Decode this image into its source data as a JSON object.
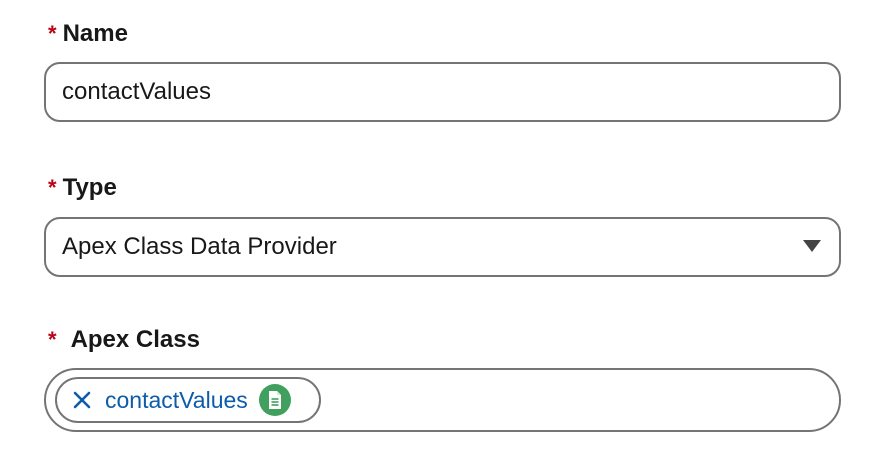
{
  "name_field": {
    "required_marker": "*",
    "label": "Name",
    "value": "contactValues"
  },
  "type_field": {
    "required_marker": "*",
    "label": "Type",
    "selected_value": "Apex Class Data Provider",
    "icon": "chevron-down-icon"
  },
  "apex_class_field": {
    "required_marker": "*",
    "label": "Apex Class",
    "selected_pill": {
      "label": "contactValues",
      "remove_icon": "close-icon",
      "type_icon": "document-icon",
      "type_icon_color": "#41a05d"
    }
  },
  "colors": {
    "required": "#ba0517",
    "pill_text": "#0b5cab",
    "border": "#747474"
  }
}
